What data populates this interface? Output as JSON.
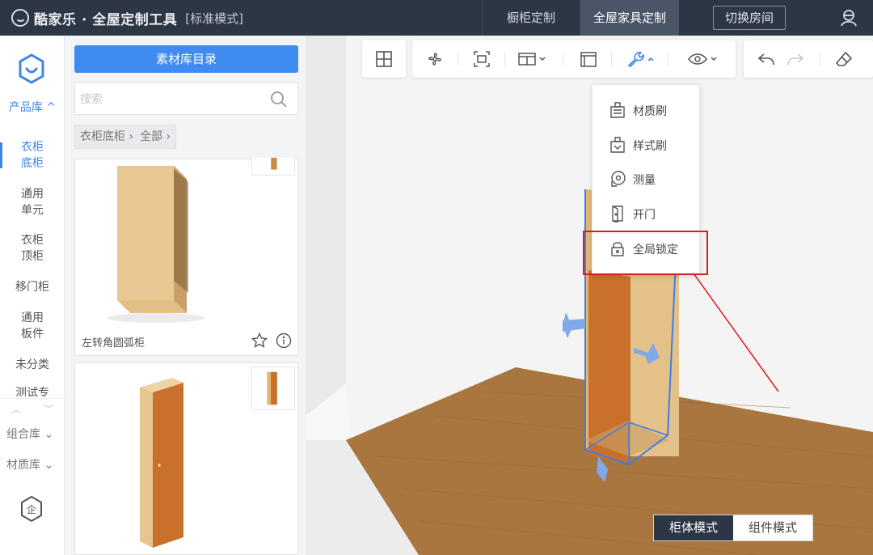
{
  "app": {
    "brand_name": "酷家乐 · 全屋定制工具",
    "mode_label": "[标准模式]"
  },
  "top_tabs": [
    {
      "label": "橱柜定制",
      "active": false
    },
    {
      "label": "全屋家具定制",
      "active": true
    }
  ],
  "switch_room_label": "切换房间",
  "sidebar": {
    "category_label": "产品库 ^",
    "items": [
      {
        "label": "衣柜底柜",
        "active": true
      },
      {
        "label": "通用单元",
        "active": false
      },
      {
        "label": "衣柜顶柜",
        "active": false
      },
      {
        "label": "移门柜",
        "active": false
      },
      {
        "label": "通用板件",
        "active": false
      },
      {
        "label": "未分类",
        "active": false
      },
      {
        "label": "测试专",
        "active": false
      }
    ],
    "combo_label": "组合库 ⌄",
    "material_label": "材质库 ⌄"
  },
  "panel": {
    "catalog_button": "素材库目录",
    "search_placeholder": "搜索",
    "breadcrumb": [
      "衣柜底柜 ›",
      "全部 ›"
    ],
    "cards": [
      {
        "name": "左转角圆弧柜"
      },
      {
        "name": ""
      }
    ]
  },
  "collapse_label": "◂◂",
  "toolbar": {
    "icons": [
      "layout-icon",
      "fan-icon",
      "select-icon",
      "door-panel-icon",
      "frame-icon",
      "wrench-icon",
      "eye-icon",
      "undo-icon",
      "redo-icon",
      "eraser-icon"
    ]
  },
  "tools_menu": [
    {
      "label": "材质刷",
      "icon": "material-brush-icon"
    },
    {
      "label": "样式刷",
      "icon": "style-brush-icon"
    },
    {
      "label": "测量",
      "icon": "measure-icon"
    },
    {
      "label": "开门",
      "icon": "open-door-icon"
    },
    {
      "label": "全局锁定",
      "icon": "lock-icon"
    }
  ],
  "view_modes": [
    {
      "label": "柜体模式",
      "active": true
    },
    {
      "label": "组件模式",
      "active": false
    }
  ],
  "colors": {
    "topbar": "#2c3645",
    "accent": "#3f8cf0",
    "highlight": "#d61f1f",
    "floor": "#a9763f",
    "cabinet_door": "#c9702d",
    "cabinet_body": "#e0b77a"
  }
}
